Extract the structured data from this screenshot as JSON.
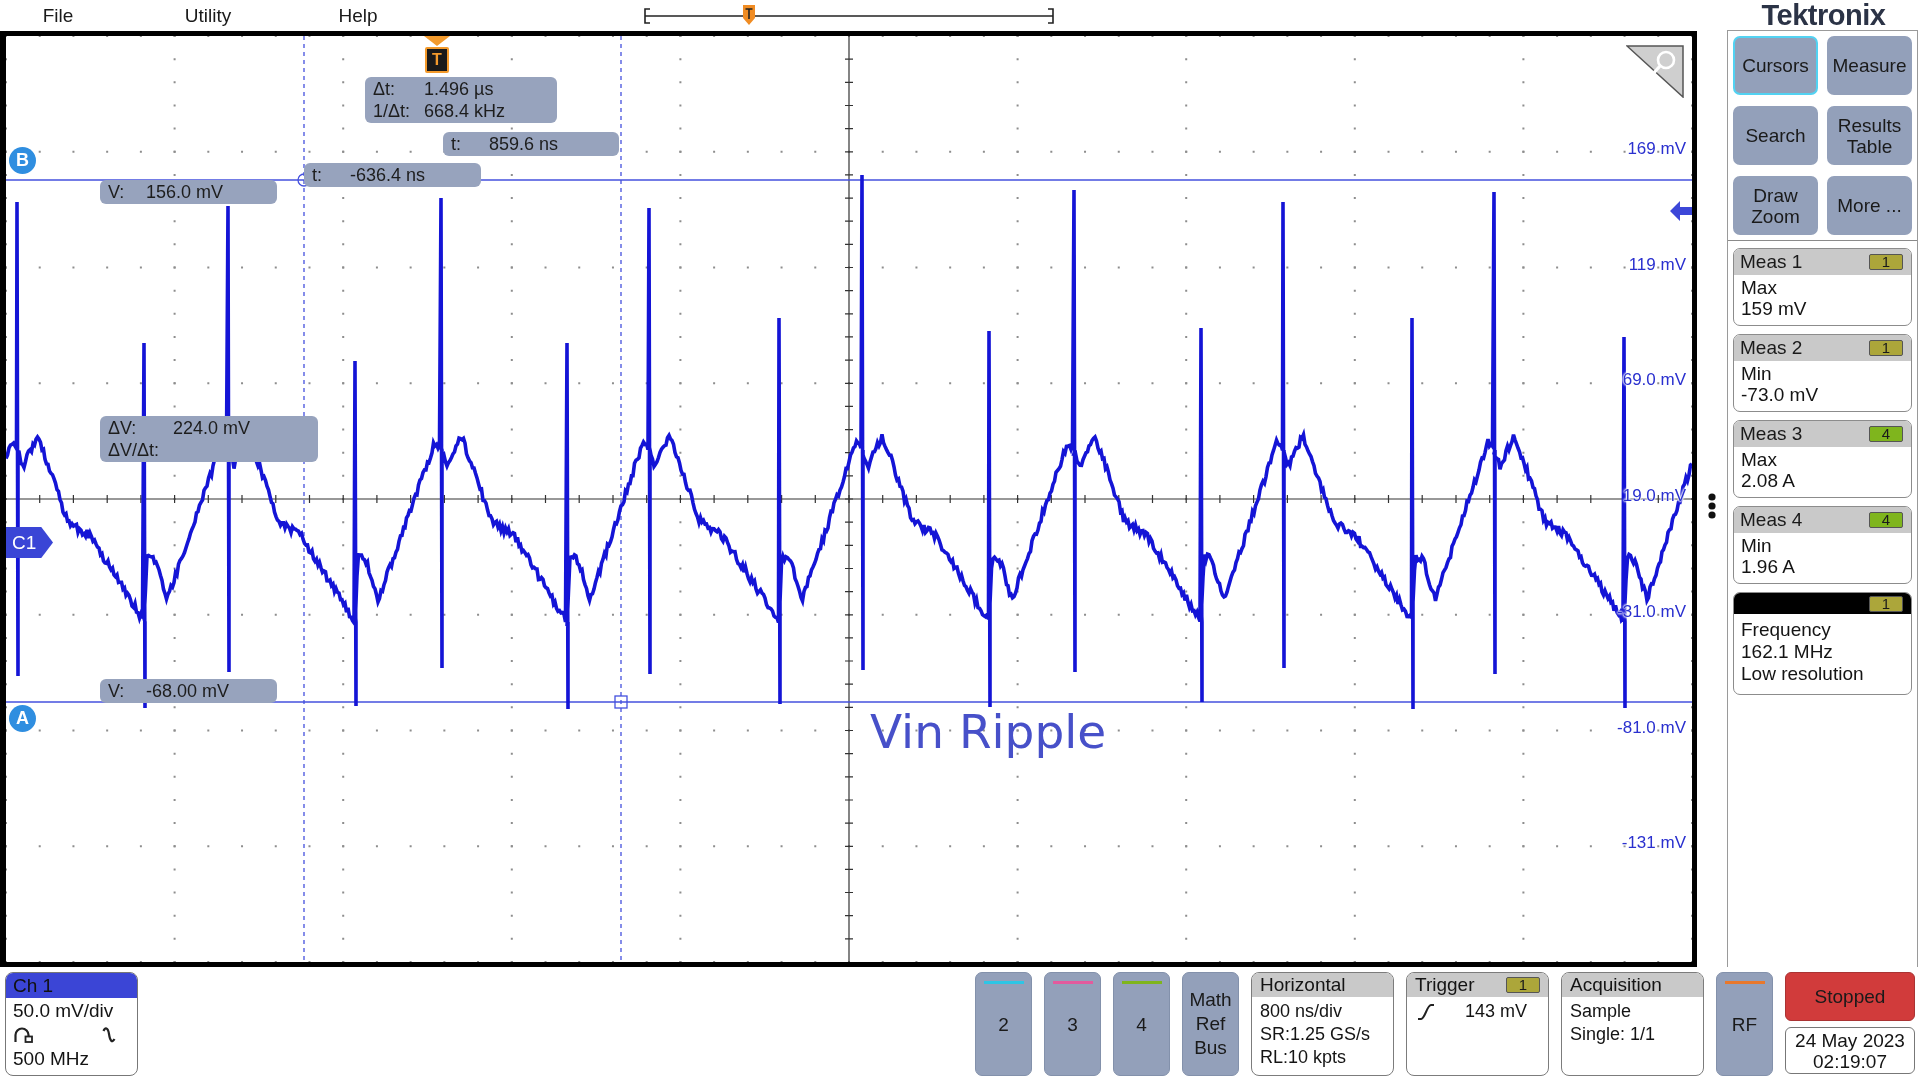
{
  "menu": [
    "File",
    "Utility",
    "Help"
  ],
  "logo": "Tektronix",
  "waveform_view": {
    "trigger_marker": "T",
    "cursor_readouts": [
      {
        "kind": "time_delta",
        "lines": [
          {
            "label": "Δt:",
            "value": "1.496 µs"
          },
          {
            "label": "1/Δt:",
            "value": "668.4 kHz"
          }
        ]
      },
      {
        "kind": "time_b",
        "lines": [
          {
            "label": "t:",
            "value": "859.6 ns"
          }
        ]
      },
      {
        "kind": "time_a",
        "lines": [
          {
            "label": "t:",
            "value": "-636.4 ns"
          }
        ]
      },
      {
        "kind": "volt_b",
        "lines": [
          {
            "label": "V:",
            "value": "156.0 mV"
          }
        ]
      },
      {
        "kind": "volt_delta",
        "lines": [
          {
            "label": "ΔV:",
            "value": "224.0 mV"
          },
          {
            "label": "ΔV/Δt:"
          }
        ]
      },
      {
        "kind": "volt_a",
        "lines": [
          {
            "label": "V:",
            "value": "-68.00 mV"
          }
        ]
      }
    ],
    "cursor_labels": [
      "B",
      "A"
    ],
    "scale_labels": [
      "169 mV",
      "119 mV",
      "69.0 mV",
      "19.0 mV",
      "-31.0 mV",
      "-81.0 mV",
      "-131 mV"
    ],
    "channel_marker": "C1",
    "annotation": "Vin Ripple"
  },
  "side_panel": {
    "buttons": [
      {
        "label": "Cursors",
        "selected": true
      },
      {
        "label": "Measure",
        "selected": false
      },
      {
        "label": "Search",
        "selected": false
      },
      {
        "label": "Results Table",
        "selected": false
      },
      {
        "label": "Draw Zoom",
        "selected": false
      },
      {
        "label": "More ...",
        "selected": false
      }
    ],
    "measurements": [
      {
        "kind": "measurement",
        "title": "Meas 1",
        "source": "1",
        "color": "#aca63a",
        "lines": [
          "Max",
          "159 mV"
        ]
      },
      {
        "kind": "measurement",
        "title": "Meas 2",
        "source": "1",
        "color": "#aca63a",
        "lines": [
          "Min",
          "-73.0 mV"
        ]
      },
      {
        "kind": "measurement",
        "title": "Meas 3",
        "source": "4",
        "color": "#7fb51d",
        "lines": [
          "Max",
          "2.08 A"
        ]
      },
      {
        "kind": "measurement",
        "title": "Meas 4",
        "source": "4",
        "color": "#7fb51d",
        "lines": [
          "Min",
          "1.96 A"
        ]
      },
      {
        "kind": "counter",
        "source": "1",
        "color": "#aca63a",
        "lines": [
          "Frequency",
          "162.1 MHz",
          "Low resolution"
        ]
      }
    ]
  },
  "bottom_bar": {
    "channel_badge": {
      "title": "Ch 1",
      "scale": "50.0 mV/div",
      "bandwidth": "500 MHz"
    },
    "channel_buttons": [
      {
        "label": "2",
        "color": "#2ec5e5"
      },
      {
        "label": "3",
        "color": "#e35b9d"
      },
      {
        "label": "4",
        "color": "#7fb51d"
      },
      {
        "label": "Math Ref Bus"
      }
    ],
    "horizontal": {
      "title": "Horizontal",
      "lines": [
        "800 ns/div",
        "SR:1.25 GS/s",
        "RL:10 kpts"
      ]
    },
    "trigger": {
      "title": "Trigger",
      "source": "1",
      "rising_edge": true,
      "value": "143 mV"
    },
    "acquisition": {
      "title": "Acquisition",
      "lines": [
        "Sample",
        "Single: 1/1"
      ]
    },
    "rf_button": {
      "label": "RF"
    },
    "run_state": {
      "label": "Stopped",
      "running": false
    },
    "date": "24 May 2023",
    "time": "02:19:07"
  }
}
